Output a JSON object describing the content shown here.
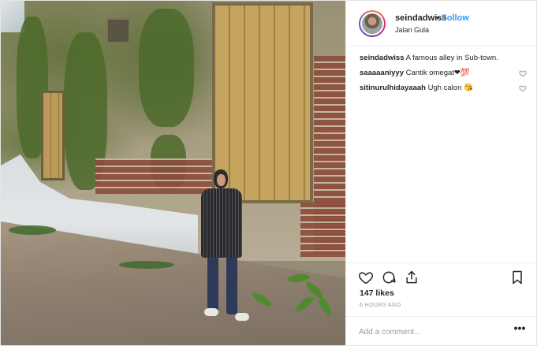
{
  "post": {
    "username": "seindadwiss",
    "separator": "•",
    "follow_label": "Follow",
    "location": "Jalan Gula",
    "caption_user": "seindadwiss",
    "caption_text": "A famous alley in Sub-town."
  },
  "comments": [
    {
      "user": "saaaaaniyyy",
      "text": "Cantik omegat❤💯"
    },
    {
      "user": "sitinurulhidayaaah",
      "text": "Ugh calon 😘"
    }
  ],
  "likes": "147 likes",
  "timestamp": "6 HOURS AGO",
  "comment_placeholder": "Add a comment...",
  "more_label": "•••",
  "icons": [
    "heart-icon",
    "comment-icon",
    "share-icon",
    "bookmark-icon",
    "more-options-icon"
  ],
  "colors": {
    "link": "#3897f0",
    "text": "#262626",
    "muted": "#999999",
    "border": "#efefef"
  }
}
